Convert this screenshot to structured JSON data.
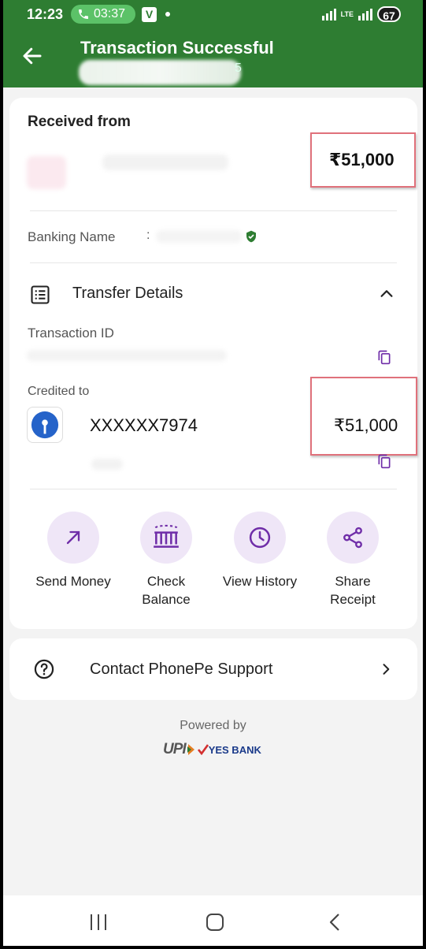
{
  "status_bar": {
    "time": "12:23",
    "call_timer": "03:37",
    "app_badge": "V",
    "network": "LTE",
    "battery": "67"
  },
  "header": {
    "title": "Transaction Successful",
    "subtitle_tail": "5"
  },
  "received": {
    "heading": "Received from",
    "amount": "₹51,000"
  },
  "banking": {
    "label": "Banking Name",
    "separator": ":"
  },
  "transfer": {
    "heading": "Transfer Details",
    "transaction_id_label": "Transaction ID",
    "credited_label": "Credited to",
    "account": "XXXXXX7974",
    "credited_amount": "₹51,000"
  },
  "actions": [
    {
      "label": "Send Money",
      "icon": "arrow-up-right-icon"
    },
    {
      "label": "Check Balance",
      "icon": "bank-icon"
    },
    {
      "label": "View History",
      "icon": "clock-icon"
    },
    {
      "label": "Share Receipt",
      "icon": "share-icon"
    }
  ],
  "support": {
    "label": "Contact PhonePe Support"
  },
  "footer": {
    "powered_by": "Powered by",
    "upi": "UPI",
    "bank": "YES BANK"
  },
  "colors": {
    "brand_green": "#2e7d32",
    "accent_purple": "#6f2da8",
    "action_bg": "#efe6f7",
    "highlight_red": "#e0717b"
  }
}
